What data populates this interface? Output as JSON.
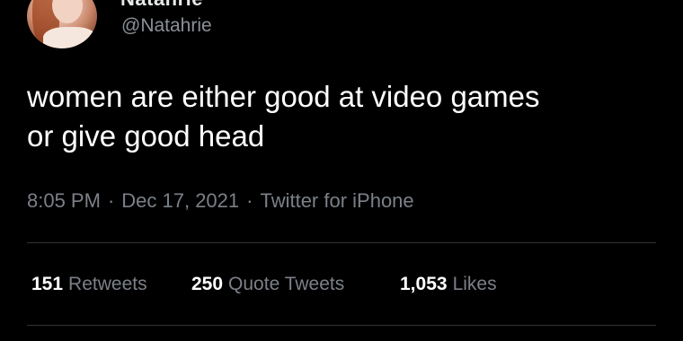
{
  "tweet": {
    "display_name": "Natahrie",
    "handle": "@Natahrie",
    "text_lines": [
      "women are either good at video games",
      "or give good head"
    ],
    "time": "8:05 PM",
    "date": "Dec 17, 2021",
    "source": "Twitter for iPhone",
    "separator": "·"
  },
  "stats": {
    "retweets": {
      "count": "151",
      "label": "Retweets"
    },
    "quote_tweets": {
      "count": "250",
      "label": "Quote Tweets"
    },
    "likes": {
      "count": "1,053",
      "label": "Likes"
    }
  },
  "colors": {
    "background": "#000000",
    "text_primary": "#ffffff",
    "text_secondary": "#7b8087",
    "divider": "#2f3336"
  }
}
